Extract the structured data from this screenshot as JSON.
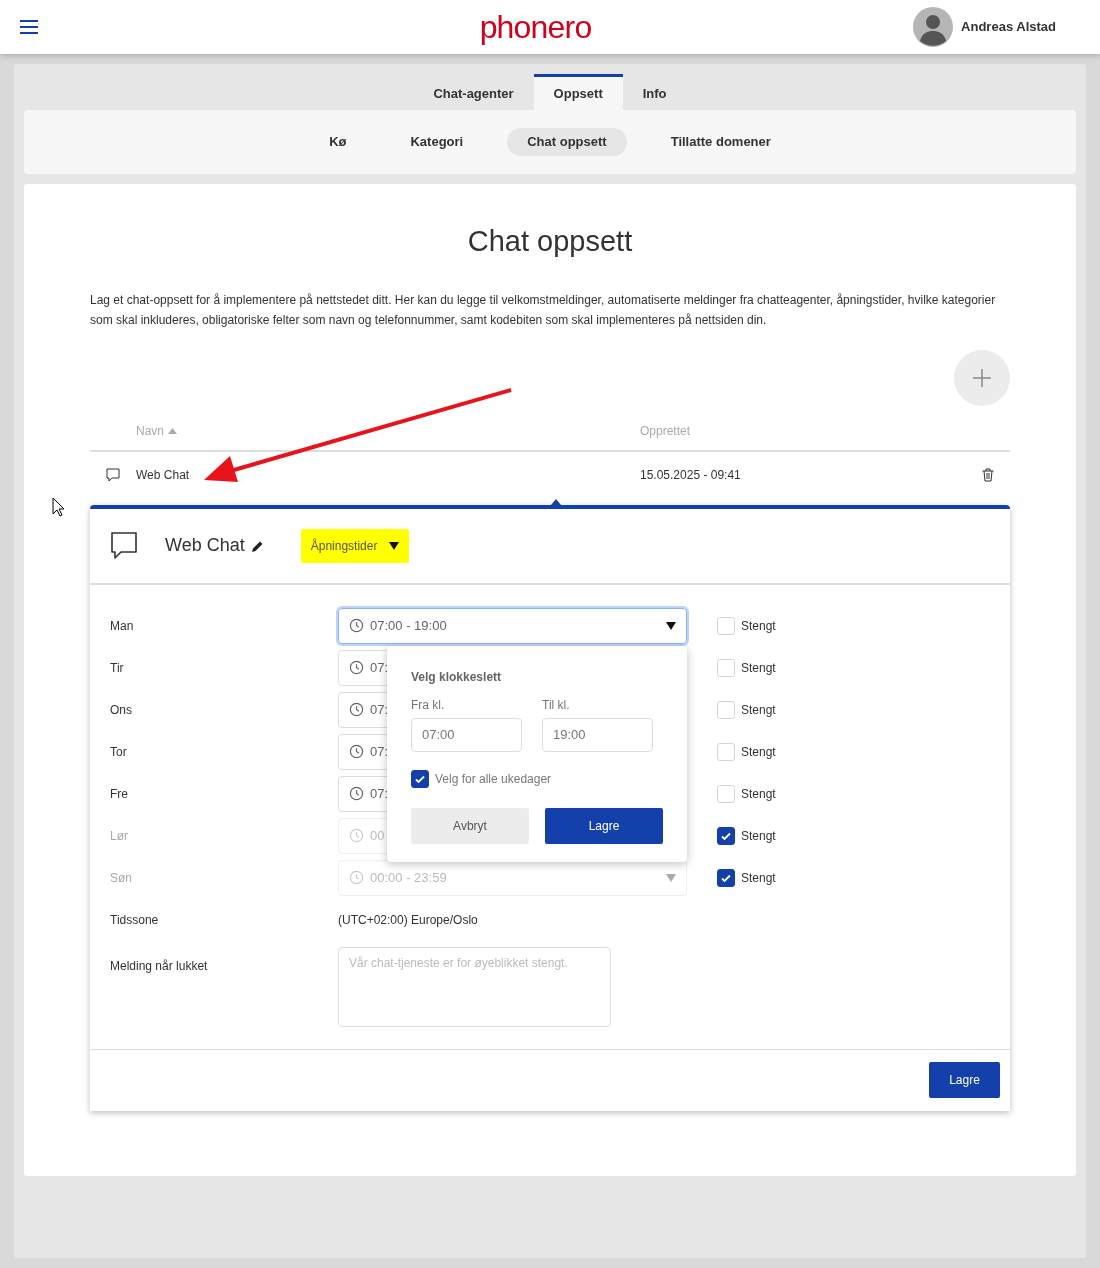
{
  "header": {
    "logo": "phonero",
    "user": "Andreas Alstad"
  },
  "tabs": [
    {
      "label": "Chat-agenter",
      "selected": false
    },
    {
      "label": "Oppsett",
      "selected": true
    },
    {
      "label": "Info",
      "selected": false
    }
  ],
  "subtabs": [
    {
      "label": "Kø",
      "selected": false
    },
    {
      "label": "Kategori",
      "selected": false
    },
    {
      "label": "Chat oppsett",
      "selected": true
    },
    {
      "label": "Tillatte domener",
      "selected": false
    }
  ],
  "page": {
    "title": "Chat oppsett",
    "description": "Lag et chat-oppsett for å implementere på nettstedet ditt. Her kan du legge til velkomstmeldinger, automatiserte meldinger fra chatteagenter, åpningstider, hvilke kategorier som skal inkluderes, obligatoriske felter som navn og telefonnummer, samt kodebiten som skal implementeres på nettsiden din."
  },
  "table": {
    "columns": [
      {
        "label": "Navn",
        "sorted": true
      },
      {
        "label": "Opprettet",
        "sorted": false
      }
    ],
    "rows": [
      {
        "name": "Web Chat",
        "created": "15.05.2025 - 09:41",
        "expanded": true
      }
    ]
  },
  "panel": {
    "title": "Web Chat",
    "section": {
      "label": "Åpningstider",
      "highlighted": true
    },
    "days": [
      {
        "label": "Man",
        "value": "07:00 - 19:00",
        "disabled": false,
        "focused": true,
        "closed_label": "Stengt",
        "closed": false
      },
      {
        "label": "Tir",
        "value": "07:",
        "disabled": false,
        "focused": false,
        "closed_label": "Stengt",
        "closed": false
      },
      {
        "label": "Ons",
        "value": "07:",
        "disabled": false,
        "focused": false,
        "closed_label": "Stengt",
        "closed": false
      },
      {
        "label": "Tor",
        "value": "07:",
        "disabled": false,
        "focused": false,
        "closed_label": "Stengt",
        "closed": false
      },
      {
        "label": "Fre",
        "value": "07:",
        "disabled": false,
        "focused": false,
        "closed_label": "Stengt",
        "closed": false
      },
      {
        "label": "Lør",
        "value": "00",
        "disabled": true,
        "focused": false,
        "closed_label": "Stengt",
        "closed": true
      },
      {
        "label": "Søn",
        "value": "00:00 - 23:59",
        "disabled": true,
        "focused": false,
        "closed_label": "Stengt",
        "closed": true
      }
    ],
    "popup": {
      "title": "Velg klokkeslett",
      "from_label": "Fra kl.",
      "from_value": "07:00",
      "to_label": "Til kl.",
      "to_value": "19:00",
      "all_days": {
        "label": "Velg for alle ukedager",
        "checked": true
      },
      "cancel": "Avbryt",
      "save": "Lagre"
    },
    "timezone": {
      "label": "Tidssone",
      "value": "(UTC+02:00) Europe/Oslo"
    },
    "closed_message": {
      "label": "Melding når lukket",
      "placeholder": "Vår chat-tjeneste er for øyeblikket stengt."
    },
    "save": "Lagre"
  }
}
